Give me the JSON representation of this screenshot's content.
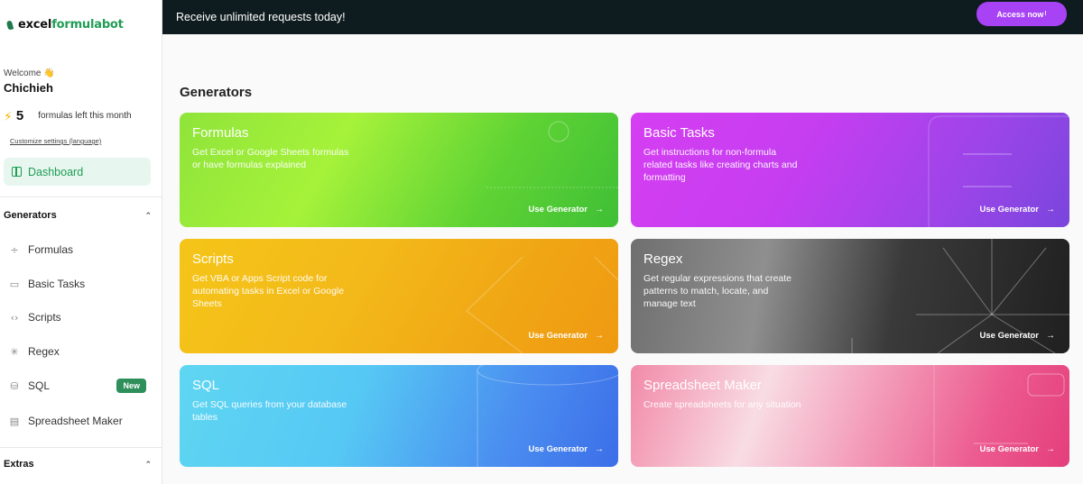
{
  "brand": {
    "logo_prefix": "excel",
    "logo_suffix": "formulabot"
  },
  "user": {
    "welcome": "Welcome 👋",
    "name": "Chichieh"
  },
  "credits": {
    "icon": "bolt-icon",
    "count": "5",
    "text": "formulas left this month"
  },
  "customize_link": "Customize settings (language)",
  "dashboard_label": "Dashboard",
  "sidebar": {
    "generators_header": "Generators",
    "items": [
      {
        "label": "Formulas",
        "icon": "divide-icon"
      },
      {
        "label": "Basic Tasks",
        "icon": "message-icon"
      },
      {
        "label": "Scripts",
        "icon": "code-icon"
      },
      {
        "label": "Regex",
        "icon": "asterisk-icon"
      },
      {
        "label": "SQL",
        "icon": "database-icon",
        "badge": "New"
      },
      {
        "label": "Spreadsheet Maker",
        "icon": "document-icon"
      }
    ],
    "extras_header": "Extras"
  },
  "banner": {
    "text": "Receive unlimited requests today!",
    "button": "Access now",
    "button_suffix": "!"
  },
  "main": {
    "title": "Generators"
  },
  "cards": [
    {
      "title": "Formulas",
      "desc": "Get Excel or Google Sheets formulas or have formulas explained",
      "cta": "Use Generator"
    },
    {
      "title": "Basic Tasks",
      "desc": "Get instructions for non-formula related tasks like creating charts and formatting",
      "cta": "Use Generator"
    },
    {
      "title": "Scripts",
      "desc": "Get VBA or Apps Script code for automating tasks in Excel or Google Sheets",
      "cta": "Use Generator"
    },
    {
      "title": "Regex",
      "desc": "Get regular expressions that create patterns to match, locate, and manage text",
      "cta": "Use Generator"
    },
    {
      "title": "SQL",
      "desc": "Get SQL queries from your database tables",
      "cta": "Use Generator"
    },
    {
      "title": "Spreadsheet Maker",
      "desc": "Create spreadsheets for any situation",
      "cta": "Use Generator"
    }
  ],
  "colors": {
    "accent": "#1f9d55",
    "banner_bg": "#0f1c1f",
    "access_button": "#a742f5"
  }
}
